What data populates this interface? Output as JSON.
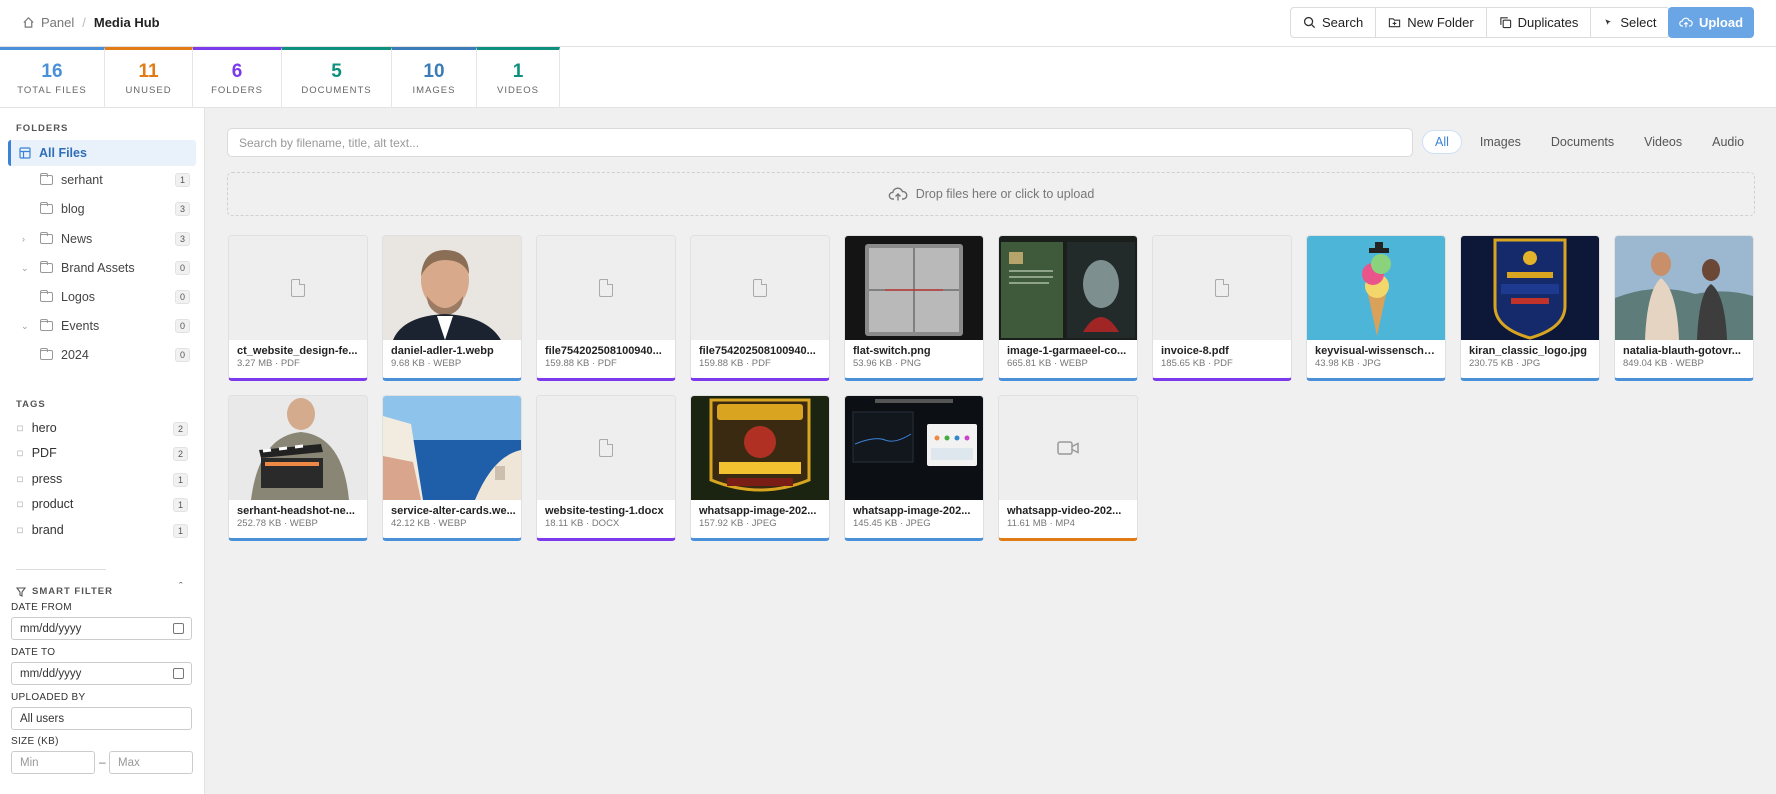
{
  "breadcrumb": {
    "home": "Panel",
    "current": "Media Hub"
  },
  "toolbar": {
    "search": "Search",
    "new_folder": "New Folder",
    "duplicates": "Duplicates",
    "select": "Select",
    "upload": "Upload"
  },
  "stats": [
    {
      "value": "16",
      "label": "TOTAL FILES",
      "color": "#4a90d9"
    },
    {
      "value": "11",
      "label": "UNUSED",
      "color": "#e07b16"
    },
    {
      "value": "6",
      "label": "FOLDERS",
      "color": "#7c3aed"
    },
    {
      "value": "5",
      "label": "DOCUMENTS",
      "color": "#0f8f7e"
    },
    {
      "value": "10",
      "label": "IMAGES",
      "color": "#3a7bb8"
    },
    {
      "value": "1",
      "label": "VIDEOS",
      "color": "#0f8f7e"
    }
  ],
  "sidebar": {
    "folders_heading": "FOLDERS",
    "all_files": "All Files",
    "folders": [
      {
        "name": "serhant",
        "count": "1"
      },
      {
        "name": "blog",
        "count": "3"
      },
      {
        "name": "News",
        "count": "3"
      },
      {
        "name": "Brand Assets",
        "count": "0"
      },
      {
        "name": "Logos",
        "count": "0"
      },
      {
        "name": "Events",
        "count": "0"
      },
      {
        "name": "2024",
        "count": "0"
      }
    ],
    "tags_heading": "TAGS",
    "tags": [
      {
        "name": "hero",
        "count": "2"
      },
      {
        "name": "PDF",
        "count": "2"
      },
      {
        "name": "press",
        "count": "1"
      },
      {
        "name": "product",
        "count": "1"
      },
      {
        "name": "brand",
        "count": "1"
      }
    ],
    "smart_filter": {
      "heading": "SMART FILTER",
      "date_from_label": "DATE FROM",
      "date_from_value": "mm/dd/yyyy",
      "date_to_label": "DATE TO",
      "date_to_value": "mm/dd/yyyy",
      "uploaded_by_label": "UPLOADED BY",
      "uploaded_by_value": "All users",
      "size_label": "SIZE (KB)",
      "size_min": "Min",
      "size_max": "Max",
      "size_sep": "–"
    }
  },
  "main": {
    "search_placeholder": "Search by filename, title, alt text...",
    "filters": [
      "All",
      "Images",
      "Documents",
      "Videos",
      "Audio"
    ],
    "dropzone": "Drop files here or click to upload",
    "files": [
      {
        "name": "ct_website_design-fe...",
        "meta": "3.27 MB · PDF",
        "kind": "doc",
        "accent": "#7c3aed"
      },
      {
        "name": "daniel-adler-1.webp",
        "meta": "9.68 KB · WEBP",
        "kind": "portrait",
        "accent": "#4a90d9"
      },
      {
        "name": "file754202508100940...",
        "meta": "159.88 KB · PDF",
        "kind": "doc",
        "accent": "#7c3aed"
      },
      {
        "name": "file754202508100940...",
        "meta": "159.88 KB · PDF",
        "kind": "doc",
        "accent": "#7c3aed"
      },
      {
        "name": "flat-switch.png",
        "meta": "53.96 KB · PNG",
        "kind": "switch",
        "accent": "#4a90d9"
      },
      {
        "name": "image-1-garmaeel-co...",
        "meta": "665.81 KB · WEBP",
        "kind": "book",
        "accent": "#4a90d9"
      },
      {
        "name": "invoice-8.pdf",
        "meta": "185.65 KB · PDF",
        "kind": "doc",
        "accent": "#7c3aed"
      },
      {
        "name": "keyvisual-wissenschaf...",
        "meta": "43.98 KB · JPG",
        "kind": "icecream",
        "accent": "#4a90d9"
      },
      {
        "name": "kiran_classic_logo.jpg",
        "meta": "230.75 KB · JPG",
        "kind": "logo",
        "accent": "#4a90d9"
      },
      {
        "name": "natalia-blauth-gotovr...",
        "meta": "849.04 KB · WEBP",
        "kind": "runners",
        "accent": "#4a90d9"
      },
      {
        "name": "serhant-headshot-ne...",
        "meta": "252.78 KB · WEBP",
        "kind": "clapper",
        "accent": "#4a90d9"
      },
      {
        "name": "service-alter-cards.we...",
        "meta": "42.12 KB · WEBP",
        "kind": "sea",
        "accent": "#4a90d9"
      },
      {
        "name": "website-testing-1.docx",
        "meta": "18.11 KB · DOCX",
        "kind": "doc",
        "accent": "#7c3aed"
      },
      {
        "name": "whatsapp-image-202...",
        "meta": "157.92 KB · JPEG",
        "kind": "poster",
        "accent": "#4a90d9"
      },
      {
        "name": "whatsapp-image-202...",
        "meta": "145.45 KB · JPEG",
        "kind": "dash",
        "accent": "#4a90d9"
      },
      {
        "name": "whatsapp-video-202...",
        "meta": "11.61 MB · MP4",
        "kind": "video",
        "accent": "#e07b16"
      }
    ]
  }
}
